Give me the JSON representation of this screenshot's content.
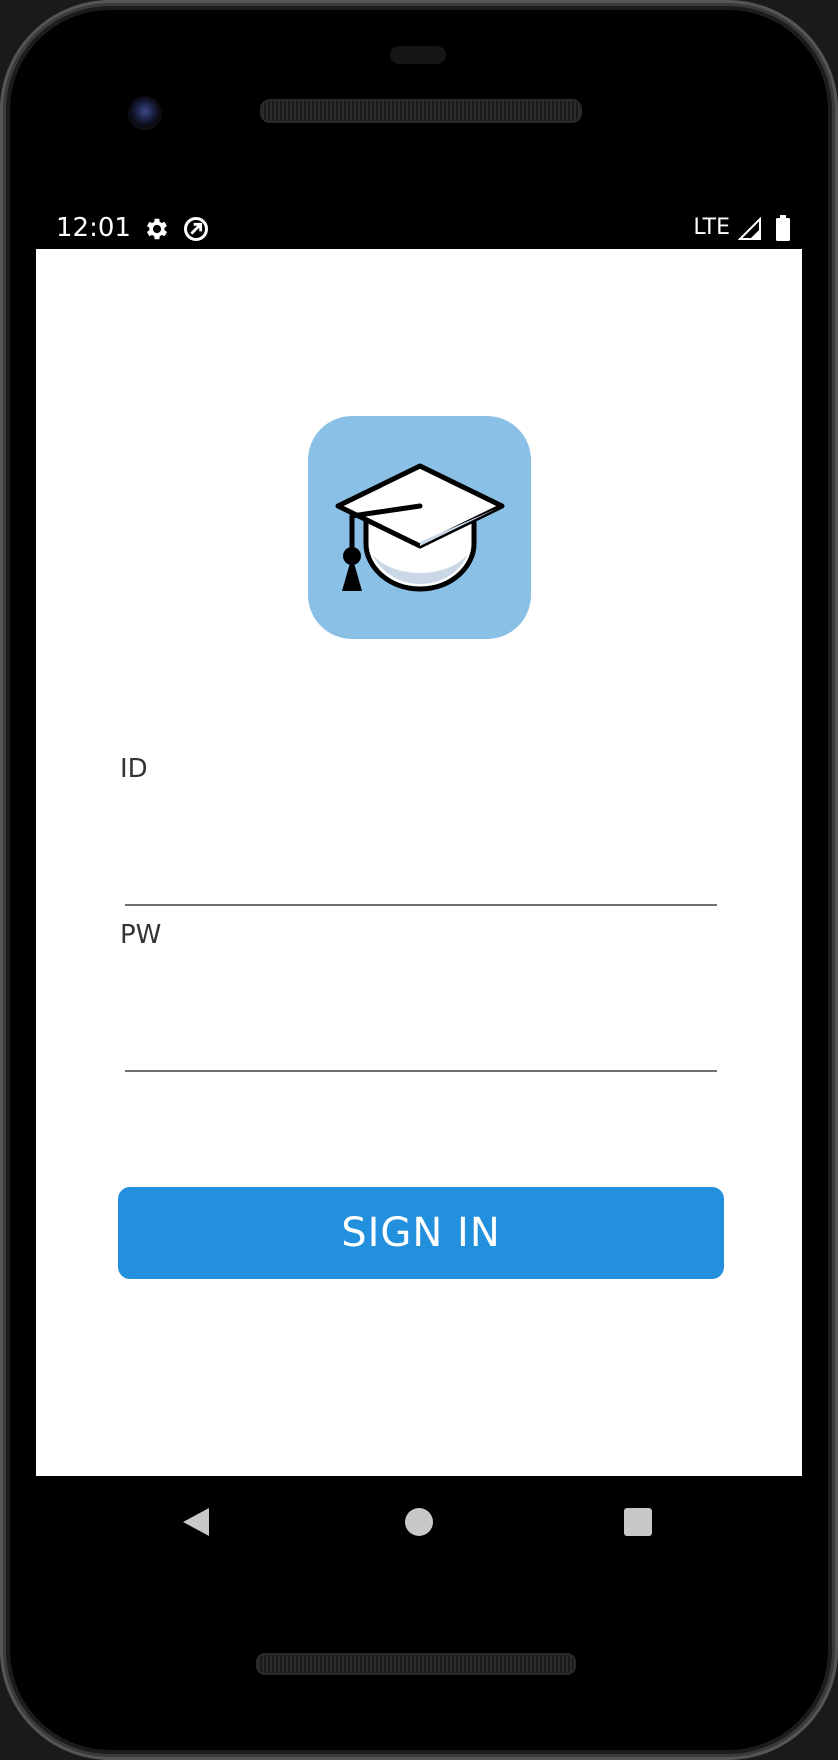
{
  "status_bar": {
    "time": "12:01",
    "network": "LTE",
    "icons": [
      "gear-icon",
      "data-saver-icon",
      "signal-icon",
      "battery-icon"
    ]
  },
  "app": {
    "logo_icon": "graduation-cap-icon",
    "logo_color": "#8ac0e6"
  },
  "login": {
    "id_label": "ID",
    "id_value": "",
    "pw_label": "PW",
    "pw_value": "",
    "signin_label": "SIGN IN",
    "button_color": "#2390dd"
  },
  "nav_bar": {
    "icons": [
      "back-icon",
      "home-icon",
      "recents-icon"
    ]
  }
}
